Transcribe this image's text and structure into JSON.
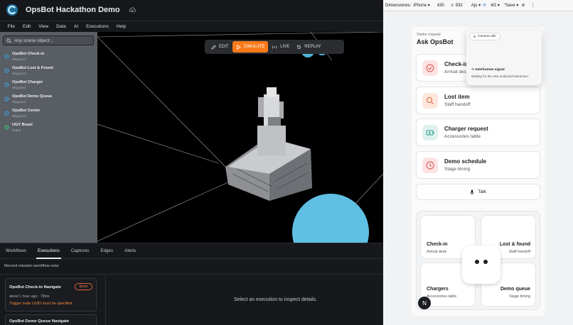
{
  "app": {
    "title": "OpsBot Hackathon Demo",
    "menu": [
      "File",
      "Edit",
      "View",
      "Data",
      "AI",
      "Executions",
      "Help"
    ],
    "search_placeholder": "Any scene object...",
    "scene_items": [
      {
        "name": "OpsBot Check-in",
        "type": "Waypoint",
        "color": "#3aa0d8"
      },
      {
        "name": "OpsBot Lost & Found",
        "type": "Waypoint",
        "color": "#3aa0d8"
      },
      {
        "name": "OpsBot Charger",
        "type": "Waypoint",
        "color": "#3aa0d8"
      },
      {
        "name": "OpsBot Demo Queue",
        "type": "Waypoint",
        "color": "#3aa0d8"
      },
      {
        "name": "OpsBot Center",
        "type": "Waypoint",
        "color": "#3aa0d8"
      },
      {
        "name": "UGV Beast",
        "type": "Robot",
        "color": "#3cc77a"
      }
    ],
    "toolbar": {
      "edit": "EDIT",
      "simulate": "SIMULATE",
      "live": "LIVE",
      "replay": "REPLAY"
    },
    "bottom_tabs": [
      "Workflows",
      "Executions",
      "Captures",
      "Edges",
      "Alerts"
    ],
    "runs_label": "Recent mission workflow runs",
    "runs": [
      {
        "name": "OpsBot Check-in Navigate",
        "status": "Error",
        "meta": "about 1 hour ago  ·  78ms",
        "error": "Trigger node UUID must be specified"
      },
      {
        "name": "OpsBot Demo Queue Navigate"
      }
    ],
    "empty_detail": "Select an execution to inspect details."
  },
  "devtools": {
    "dimensions_label": "Dimensiones:",
    "device": "iPhone",
    "width": "430",
    "x": "x",
    "height": "932",
    "zoom": "Aju",
    "network": "4G",
    "save": "Save"
  },
  "kiosk": {
    "visitor_label": "Visitor request",
    "heading": "Ask OpsBot",
    "options": [
      {
        "title": "Check-in",
        "subtitle": "Arrival desk",
        "icon": "check-circle-icon",
        "tint": "#fde3e3",
        "color": "#d9534f"
      },
      {
        "title": "Lost item",
        "subtitle": "Staff handoff",
        "icon": "search-icon",
        "tint": "#fde6da",
        "color": "#d9653a"
      },
      {
        "title": "Charger request",
        "subtitle": "Accessories table",
        "icon": "battery-icon",
        "tint": "#dff1ee",
        "color": "#2e9c8a"
      },
      {
        "title": "Demo schedule",
        "subtitle": "Stage timing",
        "icon": "clock-icon",
        "tint": "#fde3e3",
        "color": "#d9534f"
      }
    ],
    "talk_label": "Talk",
    "tiles": [
      {
        "title": "Check-in",
        "subtitle": "Arrival desk"
      },
      {
        "title": "Lost & found",
        "subtitle": "Staff handoff"
      },
      {
        "title": "Chargers",
        "subtitle": "Accessories table"
      },
      {
        "title": "Demo queue",
        "subtitle": "Stage timing"
      }
    ],
    "n_label": "N",
    "popup": {
      "camera": "Camera idle",
      "signal_title": "Interhuman signal",
      "signal_sub": "Waiting for the next analyzed interaction."
    }
  }
}
